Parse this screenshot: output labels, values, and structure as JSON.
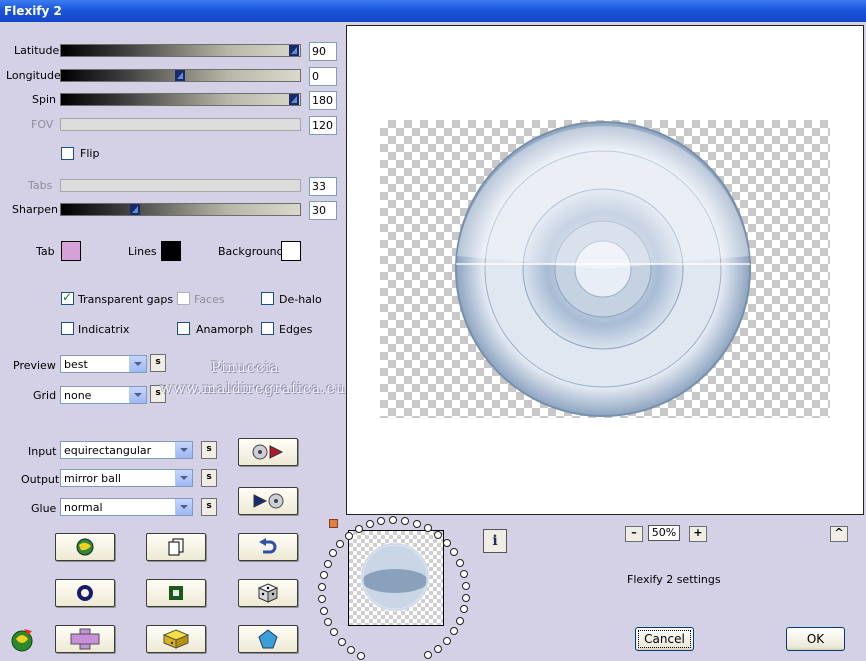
{
  "window": {
    "title": "Flexify 2"
  },
  "sliders": [
    {
      "label": "Latitude",
      "value": "90",
      "fraction": 1.0,
      "enabled": true
    },
    {
      "label": "Longitude",
      "value": "0",
      "fraction": 0.5,
      "enabled": true
    },
    {
      "label": "Spin",
      "value": "180",
      "fraction": 1.0,
      "enabled": true
    },
    {
      "label": "FOV",
      "value": "120",
      "fraction": 0,
      "enabled": false
    },
    {
      "label": "Tabs",
      "value": "33",
      "fraction": 0,
      "enabled": false
    },
    {
      "label": "Sharpen",
      "value": "30",
      "fraction": 0.3,
      "enabled": true
    }
  ],
  "flip": {
    "label": "Flip",
    "checked": false
  },
  "colors": {
    "tab": {
      "label": "Tab",
      "color": "#d8a0d8"
    },
    "lines": {
      "label": "Lines",
      "color": "#000000"
    },
    "background": {
      "label": "Background",
      "color": "#ffffff"
    }
  },
  "options": {
    "transparent_gaps": {
      "label": "Transparent gaps",
      "checked": true
    },
    "faces": {
      "label": "Faces",
      "checked": false
    },
    "de_halo": {
      "label": "De-halo",
      "checked": false
    },
    "indicatrix": {
      "label": "Indicatrix",
      "checked": false
    },
    "anamorph": {
      "label": "Anamorph",
      "checked": false
    },
    "edges": {
      "label": "Edges",
      "checked": false
    }
  },
  "preview_select": {
    "label": "Preview",
    "value": "best"
  },
  "grid_select": {
    "label": "Grid",
    "value": "none"
  },
  "input_select": {
    "label": "Input",
    "value": "equirectangular"
  },
  "output_select": {
    "label": "Output",
    "value": "mirror ball"
  },
  "glue_select": {
    "label": "Glue",
    "value": "normal"
  },
  "s_label": "s",
  "watermark": {
    "line1": "Pinuccia",
    "line2": "www.maldiregrafica.eu"
  },
  "zoom": {
    "value": "50%",
    "minus": "–",
    "plus": "+"
  },
  "caret": "^",
  "info": "i",
  "status_text": "Flexify 2 settings",
  "buttons": {
    "cancel": "Cancel",
    "ok": "OK"
  },
  "accent": "#7f9db9"
}
